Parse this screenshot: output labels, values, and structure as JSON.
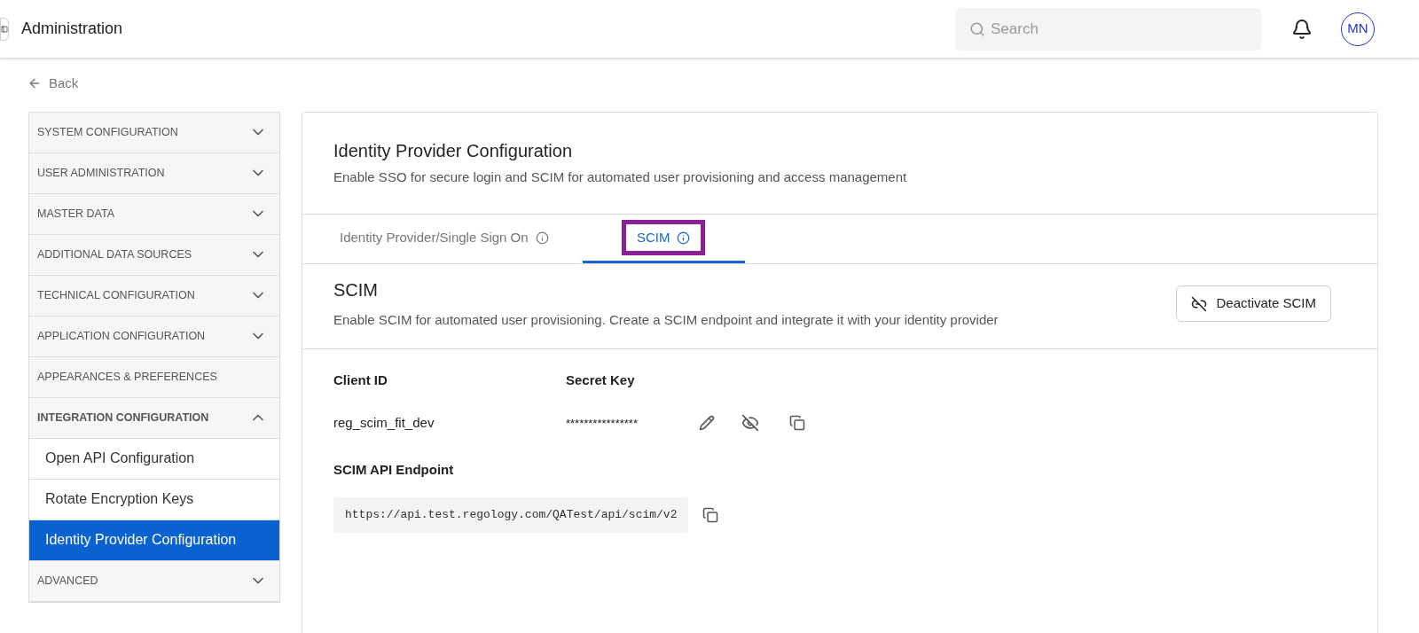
{
  "header": {
    "title": "Administration",
    "search": {
      "placeholder": "Search"
    },
    "avatar": "MN"
  },
  "back": "Back",
  "sidebar": {
    "items": [
      {
        "label": "SYSTEM CONFIGURATION",
        "kind": "section",
        "expandable": true,
        "expanded": false,
        "selected": false
      },
      {
        "label": "USER ADMINISTRATION",
        "kind": "section",
        "expandable": true,
        "expanded": false,
        "selected": false
      },
      {
        "label": "MASTER DATA",
        "kind": "section",
        "expandable": true,
        "expanded": false,
        "selected": false
      },
      {
        "label": "ADDITIONAL DATA SOURCES",
        "kind": "section",
        "expandable": true,
        "expanded": false,
        "selected": false
      },
      {
        "label": "TECHNICAL CONFIGURATION",
        "kind": "section",
        "expandable": true,
        "expanded": false,
        "selected": false
      },
      {
        "label": "APPLICATION CONFIGURATION",
        "kind": "section",
        "expandable": true,
        "expanded": false,
        "selected": false
      },
      {
        "label": "APPEARANCES & PREFERENCES",
        "kind": "section",
        "expandable": false,
        "expanded": false,
        "selected": false
      },
      {
        "label": "INTEGRATION CONFIGURATION",
        "kind": "section",
        "expandable": true,
        "expanded": true,
        "selected": false
      },
      {
        "label": "Open API Configuration",
        "kind": "sub",
        "selected": false
      },
      {
        "label": "Rotate Encryption Keys",
        "kind": "sub",
        "selected": false
      },
      {
        "label": "Identity Provider Configuration",
        "kind": "sub",
        "selected": true
      },
      {
        "label": "ADVANCED",
        "kind": "section",
        "expandable": true,
        "expanded": false,
        "selected": false
      }
    ]
  },
  "panel": {
    "title": "Identity Provider Configuration",
    "subtitle": "Enable SSO for secure login and SCIM for automated user provisioning and access management",
    "tabs": [
      {
        "label": "Identity Provider/Single Sign On",
        "selected": false,
        "highlighted": false
      },
      {
        "label": "SCIM",
        "selected": true,
        "highlighted": true
      }
    ],
    "section": {
      "title": "SCIM",
      "description": "Enable SCIM for automated user provisioning. Create a SCIM endpoint and integrate it with your identity provider",
      "button": "Deactivate SCIM"
    },
    "client_id": {
      "label": "Client ID",
      "value": "reg_scim_fit_dev"
    },
    "secret_key": {
      "label": "Secret Key",
      "value": "****************",
      "visible": false
    },
    "endpoint": {
      "label": "SCIM API Endpoint",
      "value": "https://api.test.regology.com/QATest/api/scim/v2"
    }
  }
}
